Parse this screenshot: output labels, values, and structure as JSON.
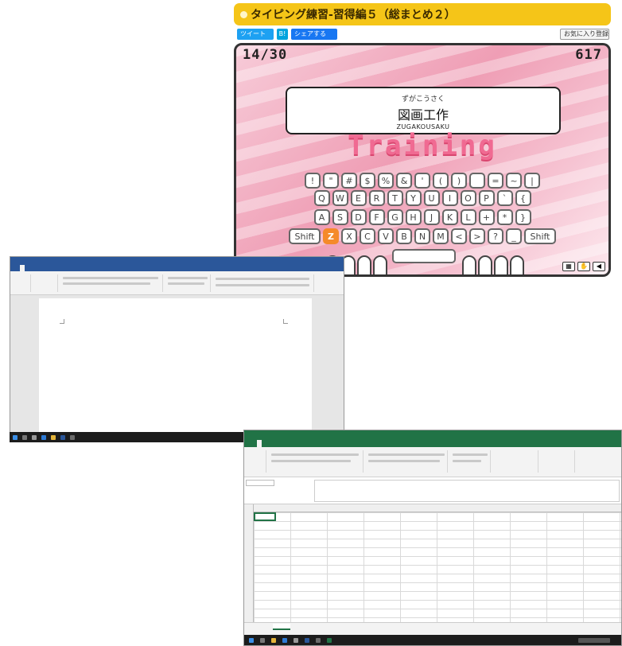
{
  "game": {
    "title": "タイピング練習-習得編５（総まとめ２）",
    "share": {
      "tweet": "ツイート",
      "hatena": "B!",
      "facebook": "シェアする",
      "favorite": "お気に入り登録"
    },
    "progress": "14/30",
    "score": "617",
    "word": {
      "kana": "ずがこうさく",
      "kanji": "図画工作",
      "romaji": "ZUGAKOUSAKU"
    },
    "training_label": "Training",
    "keyboard": {
      "row1": [
        "!",
        "\"",
        "#",
        "$",
        "%",
        "&",
        "'",
        "(",
        ")",
        "",
        "=",
        "~",
        "|"
      ],
      "row2": [
        "Q",
        "W",
        "E",
        "R",
        "T",
        "Y",
        "U",
        "I",
        "O",
        "P",
        "`",
        "{"
      ],
      "row3": [
        "A",
        "S",
        "D",
        "F",
        "G",
        "H",
        "J",
        "K",
        "L",
        "+",
        "*",
        "}"
      ],
      "row4": [
        "Shift",
        "Z",
        "X",
        "C",
        "V",
        "B",
        "N",
        "M",
        "<",
        ">",
        "?",
        "_",
        "Shift"
      ],
      "active_key": "Z"
    },
    "colors": {
      "title_bar": "#f5c518",
      "active_key": "#f58a2a",
      "training": "#f06a92"
    }
  },
  "word_window": {
    "app": "Word",
    "accent": "#2b579a",
    "tab_active_index": 1
  },
  "excel_window": {
    "app": "Excel",
    "accent": "#217346"
  }
}
